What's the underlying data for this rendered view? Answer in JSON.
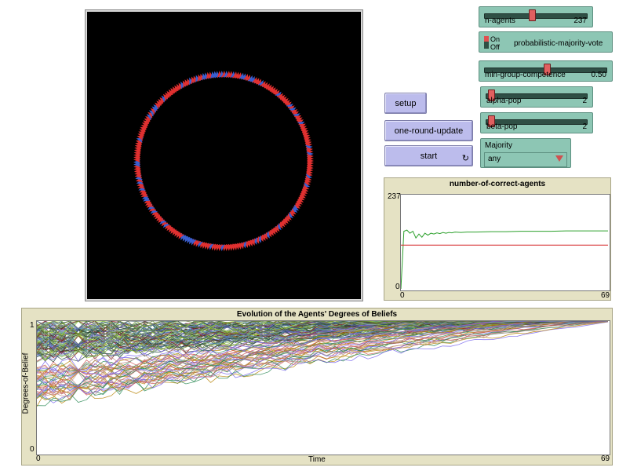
{
  "buttons": {
    "setup": "setup",
    "one_round_update": "one-round-update",
    "start": "start",
    "start_icon": "forever-icon"
  },
  "sliders": {
    "n_agents": {
      "label": "n-agents",
      "value": "237",
      "level": 0.45
    },
    "min_group_competence": {
      "label": "min-group-competence",
      "value": "0.50",
      "level": 0.5
    },
    "alpha_pop": {
      "label": "alpha-pop",
      "value": "2",
      "level": 0.02
    },
    "beta_pop": {
      "label": "beta-pop",
      "value": "2",
      "level": 0.02
    }
  },
  "switch": {
    "label": "probabilistic-majority-vote",
    "on": "On",
    "off": "Off",
    "state": "off"
  },
  "chooser": {
    "label": "Majority",
    "value": "any"
  },
  "world": {
    "agent_colors": {
      "a": "#e03030",
      "b": "#3a5fd0"
    },
    "background": "#000000"
  },
  "plot1": {
    "title": "number-of-correct-agents",
    "y_max_label": "237",
    "y_min_label": "0",
    "x_min_label": "0",
    "x_max_label": "69"
  },
  "plot2": {
    "title": "Evolution of the Agents' Degrees of Beliefs",
    "ylabel": "Degrees-of-Belief",
    "xlabel": "Time",
    "y_max_label": "1",
    "y_min_label": "0",
    "x_min_label": "0",
    "x_max_label": "69"
  },
  "chart_data": [
    {
      "type": "line",
      "title": "number-of-correct-agents",
      "xlim": [
        0,
        69
      ],
      "ylim": [
        0,
        237
      ],
      "series": [
        {
          "color": "#2ca02c",
          "x": [
            0,
            1,
            2,
            3,
            4,
            5,
            6,
            7,
            8,
            9,
            10,
            11,
            12,
            13,
            14,
            15,
            16,
            17,
            18,
            20,
            22,
            25,
            30,
            35,
            40,
            45,
            50,
            55,
            60,
            65,
            69
          ],
          "y": [
            0,
            145,
            148,
            140,
            145,
            128,
            138,
            130,
            140,
            135,
            140,
            138,
            141,
            139,
            142,
            140,
            142,
            141,
            143,
            142,
            143,
            143,
            144,
            144,
            145,
            145,
            145,
            146,
            146,
            146,
            146
          ]
        },
        {
          "color": "#d62728",
          "x": [
            0,
            69
          ],
          "y": [
            110,
            110
          ]
        }
      ]
    },
    {
      "type": "line",
      "title": "Evolution of the Agents' Degrees of Beliefs",
      "xlabel": "Time",
      "ylabel": "Degrees-of-Belief",
      "xlim": [
        0,
        69
      ],
      "ylim": [
        0,
        1
      ],
      "series_count": 237
    }
  ]
}
